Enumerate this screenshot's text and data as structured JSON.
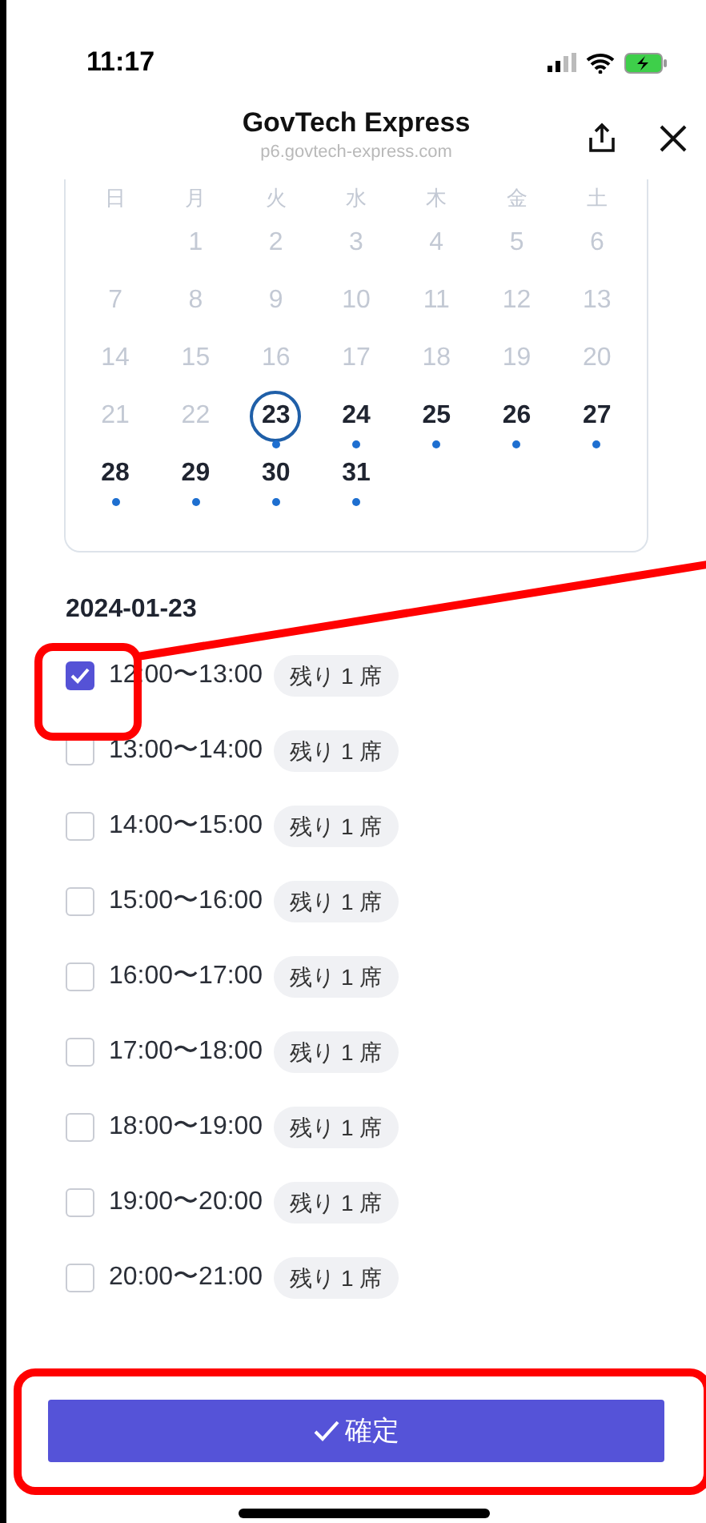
{
  "status_bar": {
    "time": "11:17"
  },
  "header": {
    "title": "GovTech Express",
    "url": "p6.govtech-express.com"
  },
  "calendar": {
    "weekdays": [
      "日",
      "月",
      "火",
      "水",
      "木",
      "金",
      "土"
    ],
    "weeks": [
      [
        {
          "kind": "empty"
        },
        {
          "kind": "day",
          "label": "1",
          "available": false,
          "selected": false
        },
        {
          "kind": "day",
          "label": "2",
          "available": false,
          "selected": false
        },
        {
          "kind": "day",
          "label": "3",
          "available": false,
          "selected": false
        },
        {
          "kind": "day",
          "label": "4",
          "available": false,
          "selected": false
        },
        {
          "kind": "day",
          "label": "5",
          "available": false,
          "selected": false
        },
        {
          "kind": "day",
          "label": "6",
          "available": false,
          "selected": false
        }
      ],
      [
        {
          "kind": "day",
          "label": "7",
          "available": false,
          "selected": false
        },
        {
          "kind": "day",
          "label": "8",
          "available": false,
          "selected": false
        },
        {
          "kind": "day",
          "label": "9",
          "available": false,
          "selected": false
        },
        {
          "kind": "day",
          "label": "10",
          "available": false,
          "selected": false
        },
        {
          "kind": "day",
          "label": "11",
          "available": false,
          "selected": false
        },
        {
          "kind": "day",
          "label": "12",
          "available": false,
          "selected": false
        },
        {
          "kind": "day",
          "label": "13",
          "available": false,
          "selected": false
        }
      ],
      [
        {
          "kind": "day",
          "label": "14",
          "available": false,
          "selected": false
        },
        {
          "kind": "day",
          "label": "15",
          "available": false,
          "selected": false
        },
        {
          "kind": "day",
          "label": "16",
          "available": false,
          "selected": false
        },
        {
          "kind": "day",
          "label": "17",
          "available": false,
          "selected": false
        },
        {
          "kind": "day",
          "label": "18",
          "available": false,
          "selected": false
        },
        {
          "kind": "day",
          "label": "19",
          "available": false,
          "selected": false
        },
        {
          "kind": "day",
          "label": "20",
          "available": false,
          "selected": false
        }
      ],
      [
        {
          "kind": "day",
          "label": "21",
          "available": false,
          "selected": false
        },
        {
          "kind": "day",
          "label": "22",
          "available": false,
          "selected": false
        },
        {
          "kind": "day",
          "label": "23",
          "available": true,
          "selected": true
        },
        {
          "kind": "day",
          "label": "24",
          "available": true,
          "selected": false
        },
        {
          "kind": "day",
          "label": "25",
          "available": true,
          "selected": false
        },
        {
          "kind": "day",
          "label": "26",
          "available": true,
          "selected": false
        },
        {
          "kind": "day",
          "label": "27",
          "available": true,
          "selected": false
        }
      ],
      [
        {
          "kind": "day",
          "label": "28",
          "available": true,
          "selected": false
        },
        {
          "kind": "day",
          "label": "29",
          "available": true,
          "selected": false
        },
        {
          "kind": "day",
          "label": "30",
          "available": true,
          "selected": false
        },
        {
          "kind": "day",
          "label": "31",
          "available": true,
          "selected": false
        }
      ]
    ]
  },
  "date_heading": "2024-01-23",
  "slots": [
    {
      "time": "12:00〜13:00",
      "badge": "残り 1 席",
      "checked": true
    },
    {
      "time": "13:00〜14:00",
      "badge": "残り 1 席",
      "checked": false
    },
    {
      "time": "14:00〜15:00",
      "badge": "残り 1 席",
      "checked": false
    },
    {
      "time": "15:00〜16:00",
      "badge": "残り 1 席",
      "checked": false
    },
    {
      "time": "16:00〜17:00",
      "badge": "残り 1 席",
      "checked": false
    },
    {
      "time": "17:00〜18:00",
      "badge": "残り 1 席",
      "checked": false
    },
    {
      "time": "18:00〜19:00",
      "badge": "残り 1 席",
      "checked": false
    },
    {
      "time": "19:00〜20:00",
      "badge": "残り 1 席",
      "checked": false
    },
    {
      "time": "20:00〜21:00",
      "badge": "残り 1 席",
      "checked": false
    }
  ],
  "confirm_button": "確定"
}
